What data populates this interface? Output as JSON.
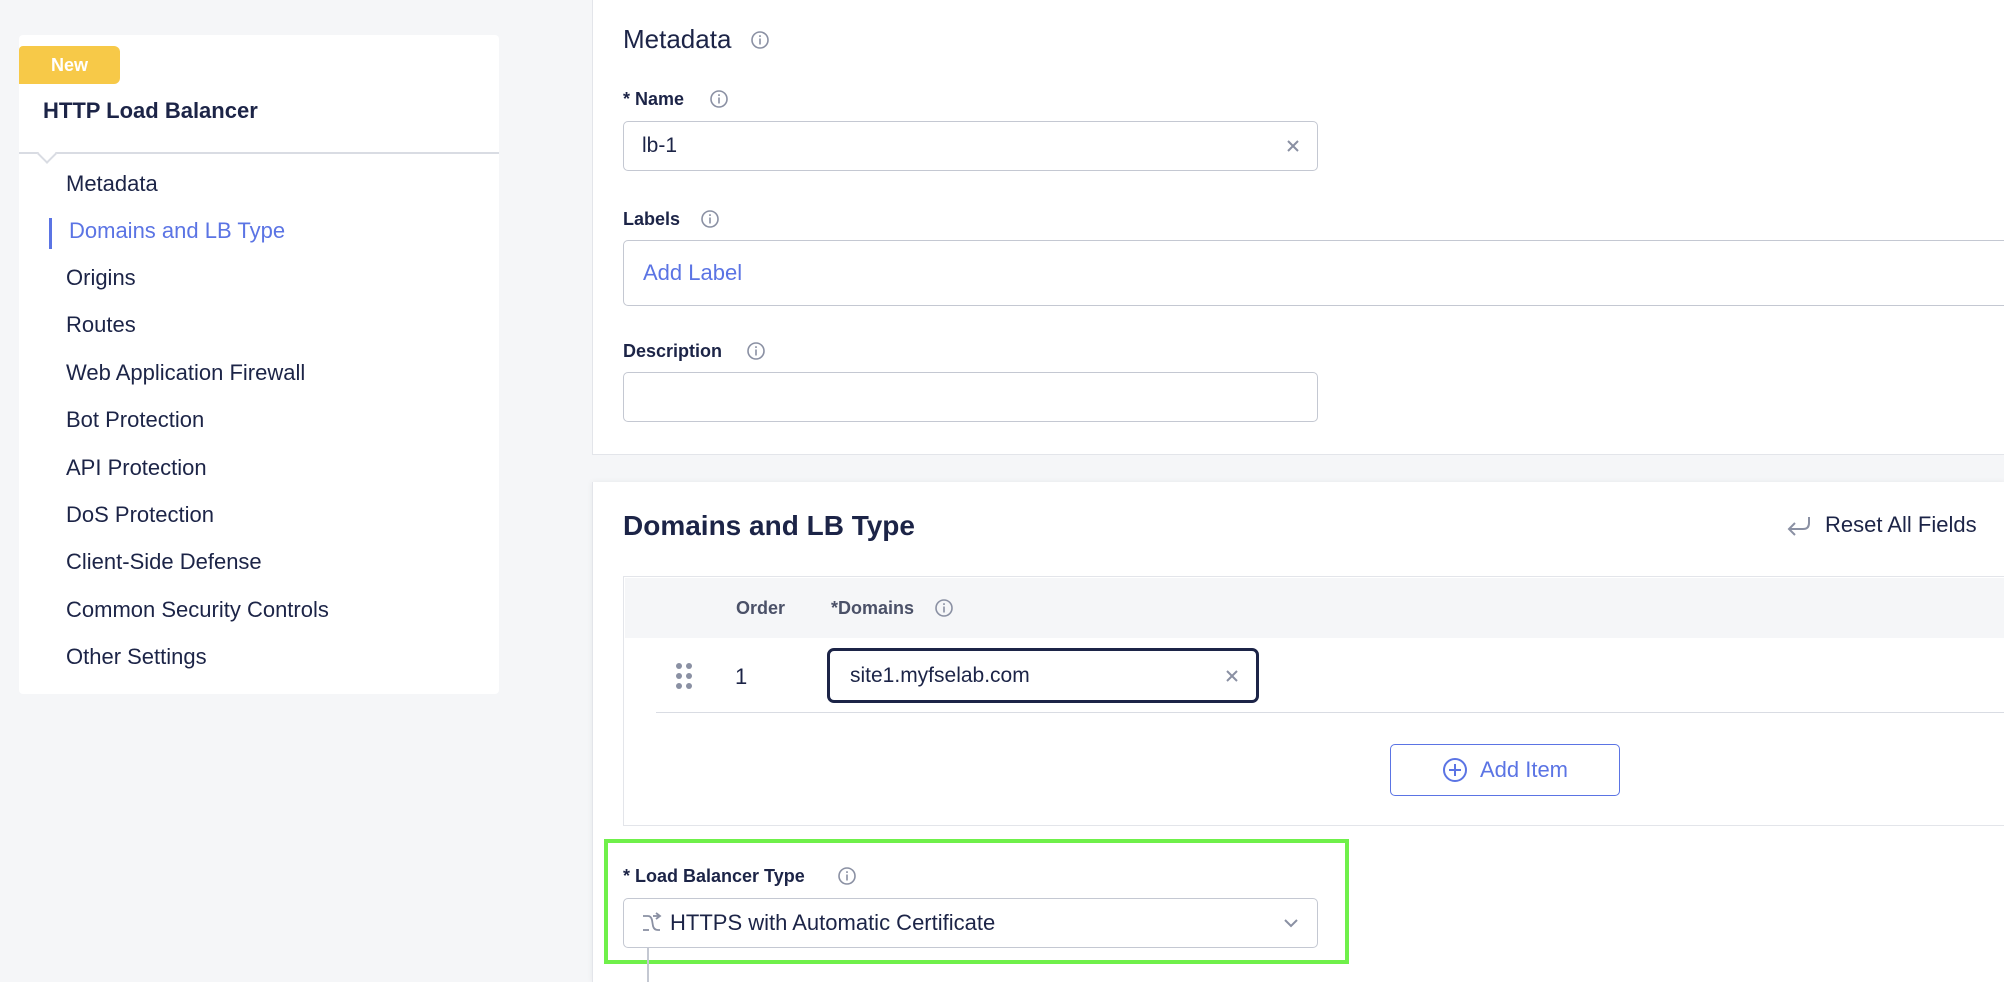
{
  "sidebar": {
    "badge": "New",
    "title": "HTTP Load Balancer",
    "items": [
      {
        "label": "Metadata"
      },
      {
        "label": "Domains and LB Type"
      },
      {
        "label": "Origins"
      },
      {
        "label": "Routes"
      },
      {
        "label": "Web Application Firewall"
      },
      {
        "label": "Bot Protection"
      },
      {
        "label": "API Protection"
      },
      {
        "label": "DoS Protection"
      },
      {
        "label": "Client-Side Defense"
      },
      {
        "label": "Common Security Controls"
      },
      {
        "label": "Other Settings"
      }
    ],
    "active_item": "Domains and LB Type"
  },
  "metadata": {
    "title": "Metadata",
    "name_label": "* Name",
    "name_value": "lb-1",
    "labels_label": "Labels",
    "add_label": "Add Label",
    "description_label": "Description",
    "description_value": ""
  },
  "domains": {
    "title": "Domains and LB Type",
    "reset_label": "Reset All Fields",
    "columns": [
      "Order",
      "*Domains"
    ],
    "rows": [
      {
        "order": "1",
        "domain": "site1.myfselab.com"
      }
    ],
    "add_item_label": "Add Item",
    "lb_type_label": "* Load Balancer Type",
    "lb_type_value": "HTTPS with Automatic Certificate"
  },
  "colors": {
    "accent": "#5b74e4",
    "text": "#1c2447",
    "badge": "#f7c948",
    "highlight": "#6ff04a"
  },
  "icons": [
    "info-icon",
    "clear-icon",
    "drag-handle-icon",
    "reset-icon",
    "add-circle-icon",
    "route-icon",
    "chevron-down-icon"
  ]
}
